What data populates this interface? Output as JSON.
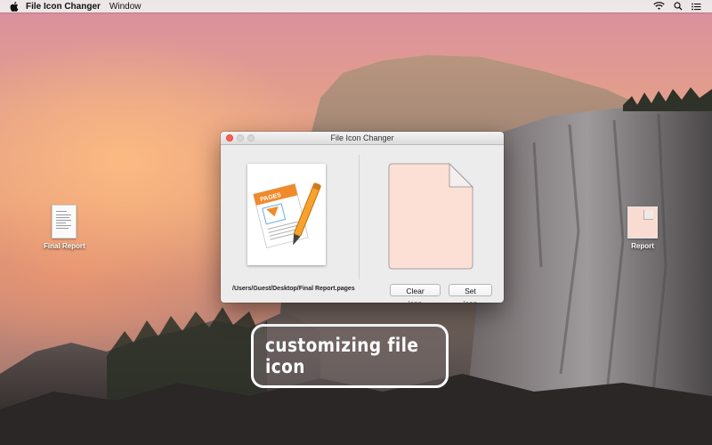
{
  "menubar": {
    "app_name": "File Icon Changer",
    "menus": [
      "Window"
    ],
    "status_icons": [
      "wifi-icon",
      "search-icon",
      "list-icon"
    ]
  },
  "desktop": {
    "icons": [
      {
        "label": "Final Report",
        "icon": "text-document-icon"
      },
      {
        "label": "Report",
        "icon": "peach-document-icon"
      }
    ]
  },
  "window": {
    "title": "File Icon Changer",
    "source_file_path": "/Users/Guest/Desktop/Final Report.pages",
    "source_icon": "pages-document-icon",
    "source_icon_badge": "PAGES",
    "target_icon": "blank-document-icon",
    "buttons": {
      "clear": "Clear icon",
      "set": "Set icon"
    }
  },
  "caption": {
    "text": "customizing file icon"
  },
  "colors": {
    "close_button": "#fc5f57",
    "target_icon_fill": "#fde0d5",
    "pages_badge": "#f08a2a"
  }
}
